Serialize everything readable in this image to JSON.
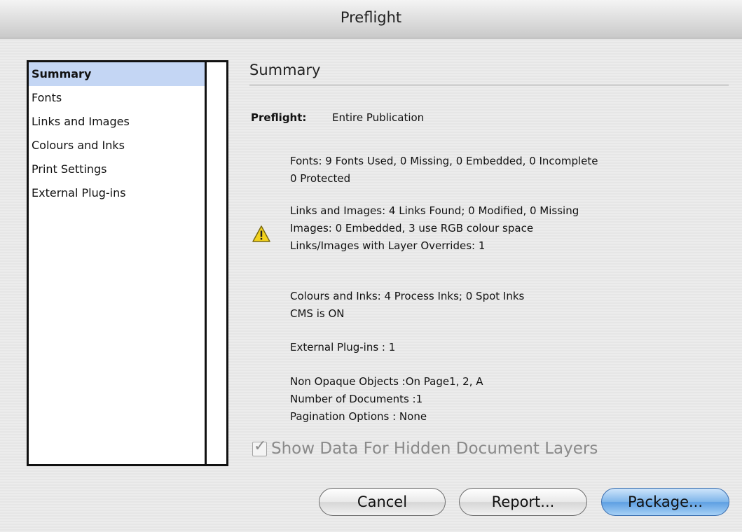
{
  "window": {
    "title": "Preflight"
  },
  "sidebar": {
    "items": [
      {
        "label": "Summary",
        "selected": true
      },
      {
        "label": "Fonts"
      },
      {
        "label": "Links and Images"
      },
      {
        "label": "Colours and Inks"
      },
      {
        "label": "Print Settings"
      },
      {
        "label": "External Plug-ins"
      }
    ]
  },
  "main": {
    "heading": "Summary",
    "preflight_label": "Preflight:",
    "preflight_value": "Entire Publication",
    "fonts": {
      "line1": "Fonts: 9 Fonts Used, 0 Missing, 0 Embedded, 0 Incomplete",
      "line2": "0 Protected"
    },
    "links": {
      "line1": "Links and Images: 4 Links Found; 0 Modified, 0 Missing",
      "line2": "Images: 0 Embedded, 3 use RGB colour space",
      "line3": "Links/Images with Layer Overrides: 1",
      "icon": "warning-icon"
    },
    "colours": {
      "line1": "Colours and Inks: 4 Process Inks; 0 Spot Inks",
      "line2": "CMS is ON"
    },
    "plugins": {
      "line1": "External Plug-ins : 1"
    },
    "other": {
      "line1": "Non Opaque Objects :On Page1, 2, A",
      "line2": "Number of Documents :1",
      "line3": "Pagination Options : None"
    },
    "show_hidden": {
      "label": "Show Data For Hidden Document Layers",
      "checked": true,
      "enabled": false
    }
  },
  "buttons": {
    "cancel": "Cancel",
    "report": "Report...",
    "package": "Package..."
  },
  "colors": {
    "selection": "#c4d6f4",
    "default_button": "#5d9fe2"
  }
}
